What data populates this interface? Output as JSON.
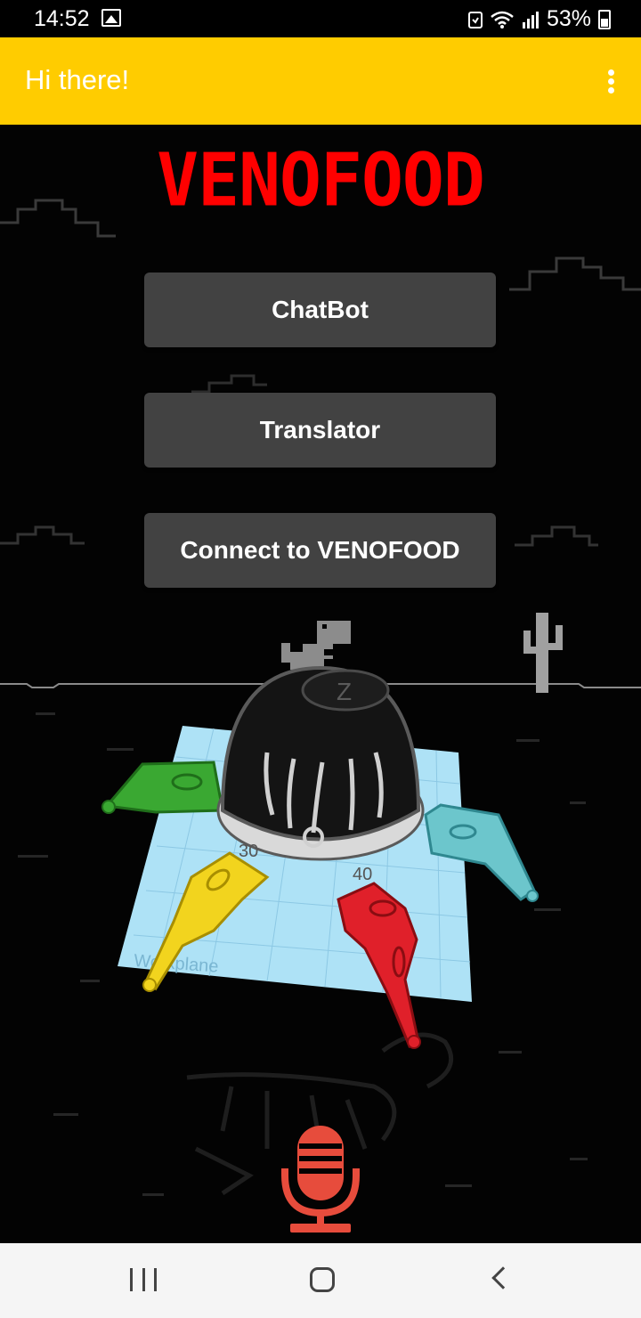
{
  "status_bar": {
    "time": "14:52",
    "battery": "53%",
    "icons": [
      "gallery-icon",
      "sync-icon",
      "wifi-icon",
      "signal-icon",
      "battery-icon"
    ]
  },
  "app_bar": {
    "title": "Hi there!",
    "menu_icon": "overflow-menu-icon"
  },
  "main": {
    "brand": "VENOFOOD",
    "buttons": {
      "chatbot": "ChatBot",
      "translator": "Translator",
      "connect": "Connect to VENOFOOD"
    },
    "illustration": {
      "workplane_label": "Workplane",
      "dome_label": "Z",
      "leg_labels": [
        "30",
        "40"
      ]
    },
    "mic_icon": "microphone-icon"
  },
  "colors": {
    "app_bar": "#FFCC00",
    "brand": "#FF0000",
    "button": "#424242",
    "mic": "#E74C3C",
    "leg_green": "#3AA832",
    "leg_yellow": "#F2D41E",
    "leg_red": "#E0202A",
    "leg_teal": "#6CC6CC"
  },
  "nav_bar": {
    "icons": [
      "recents-icon",
      "home-icon",
      "back-icon"
    ]
  }
}
